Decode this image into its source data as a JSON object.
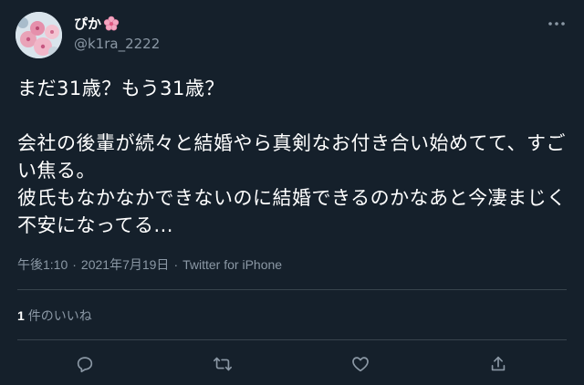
{
  "user": {
    "display_name": "ぴか",
    "handle": "@k1ra_2222",
    "name_emoji": "cherry-blossom-icon",
    "avatar": "flower-avatar"
  },
  "tweet": {
    "text": "まだ31歳？もう31歳？\n\n会社の後輩が続々と結婚やら真剣なお付き合い始めてて、すごい焦る。\n彼氏もなかなかできないのに結婚できるのかなあと今凄まじく不安になってる..."
  },
  "meta": {
    "time": "午後1:10",
    "separator": "·",
    "date": "2021年7月19日",
    "source": "Twitter for iPhone"
  },
  "stats": {
    "likes_count": "1",
    "likes_label": "件のいいね"
  },
  "actions": [
    "reply-icon",
    "retweet-icon",
    "like-icon",
    "share-icon"
  ],
  "colors": {
    "background": "#15202b",
    "text": "#ffffff",
    "secondary": "#8b98a5",
    "divider": "#38444d",
    "sakura": "#f4a6c1"
  }
}
